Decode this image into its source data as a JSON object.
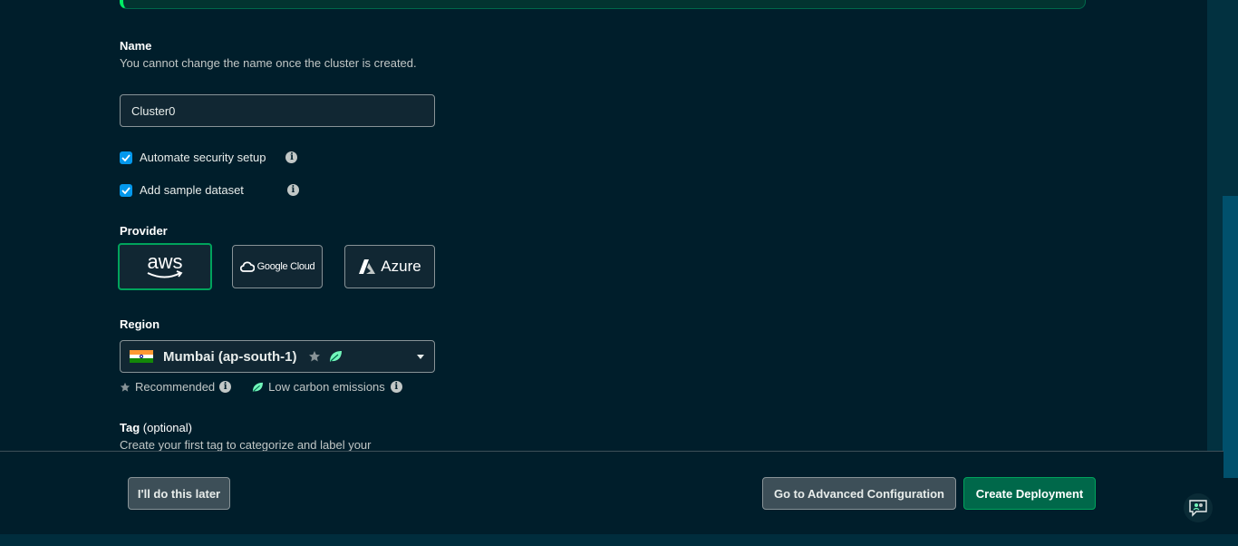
{
  "name_section": {
    "label": "Name",
    "help": "You cannot change the name once the cluster is created.",
    "value": "Cluster0"
  },
  "options": [
    {
      "label": "Automate security setup",
      "checked": true
    },
    {
      "label": "Add sample dataset",
      "checked": true
    }
  ],
  "provider": {
    "label": "Provider",
    "selected": "aws",
    "cards": [
      {
        "id": "aws",
        "label": "aws"
      },
      {
        "id": "gcp",
        "label": "Google Cloud"
      },
      {
        "id": "azure",
        "label": "Azure"
      }
    ]
  },
  "region": {
    "label": "Region",
    "selected": "Mumbai (ap-south-1)",
    "legend_recommended": "Recommended",
    "legend_low_carbon": "Low carbon emissions"
  },
  "tag": {
    "label": "Tag",
    "optional": "(optional)",
    "help": "Create your first tag to categorize and label your"
  },
  "footer": {
    "later_button": "I'll do this later",
    "advanced_button": "Go to Advanced Configuration",
    "create_button": "Create Deployment"
  },
  "colors": {
    "background": "#001e2b",
    "accent_green": "#00a35c",
    "checkbox_blue": "#0498ec",
    "leaf_green": "#71f6ba"
  }
}
